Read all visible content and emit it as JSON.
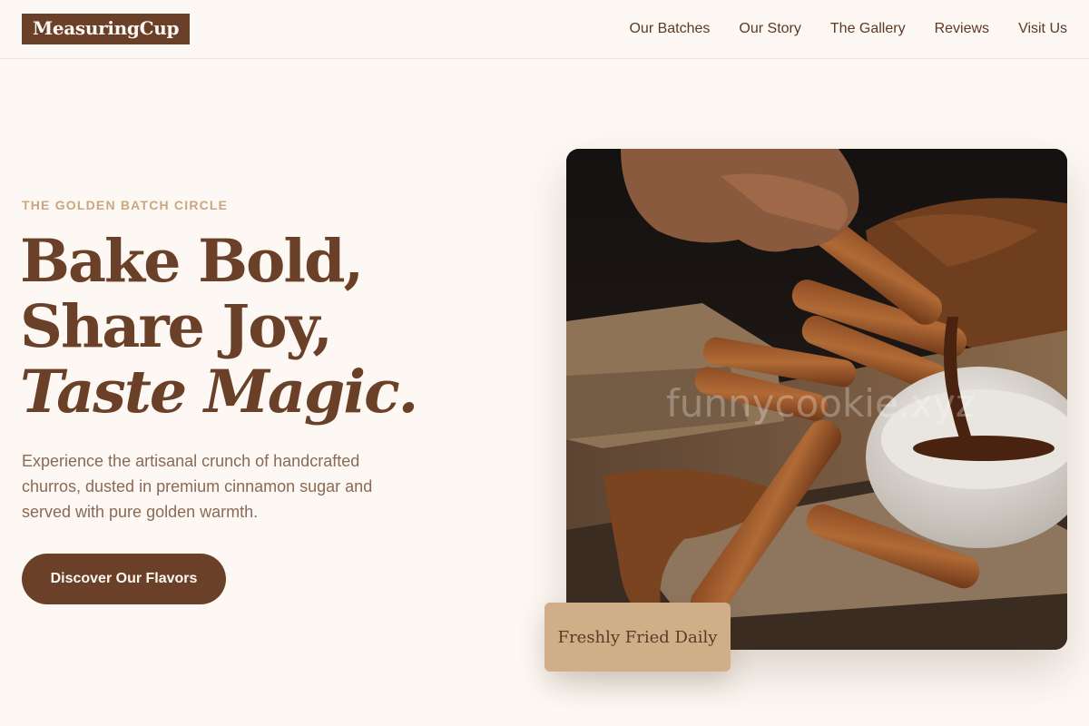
{
  "header": {
    "logo": "MeasuringCup",
    "nav": [
      "Our Batches",
      "Our Story",
      "The Gallery",
      "Reviews",
      "Visit Us"
    ]
  },
  "hero": {
    "eyebrow": "THE GOLDEN BATCH CIRCLE",
    "headline_line1": "Bake Bold,",
    "headline_line2": "Share Joy,",
    "headline_line3": "Taste Magic.",
    "description": "Experience the artisanal crunch of handcrafted churros, dusted in premium cinnamon sugar and served with pure golden warmth.",
    "cta_label": "Discover Our Flavors",
    "image_watermark": "funnycookie.xyz",
    "badge": "Freshly Fried Daily"
  },
  "colors": {
    "background": "#fdf8f3",
    "brand": "#6b4028",
    "accent": "#c9a77f",
    "badge": "#cfae88"
  }
}
